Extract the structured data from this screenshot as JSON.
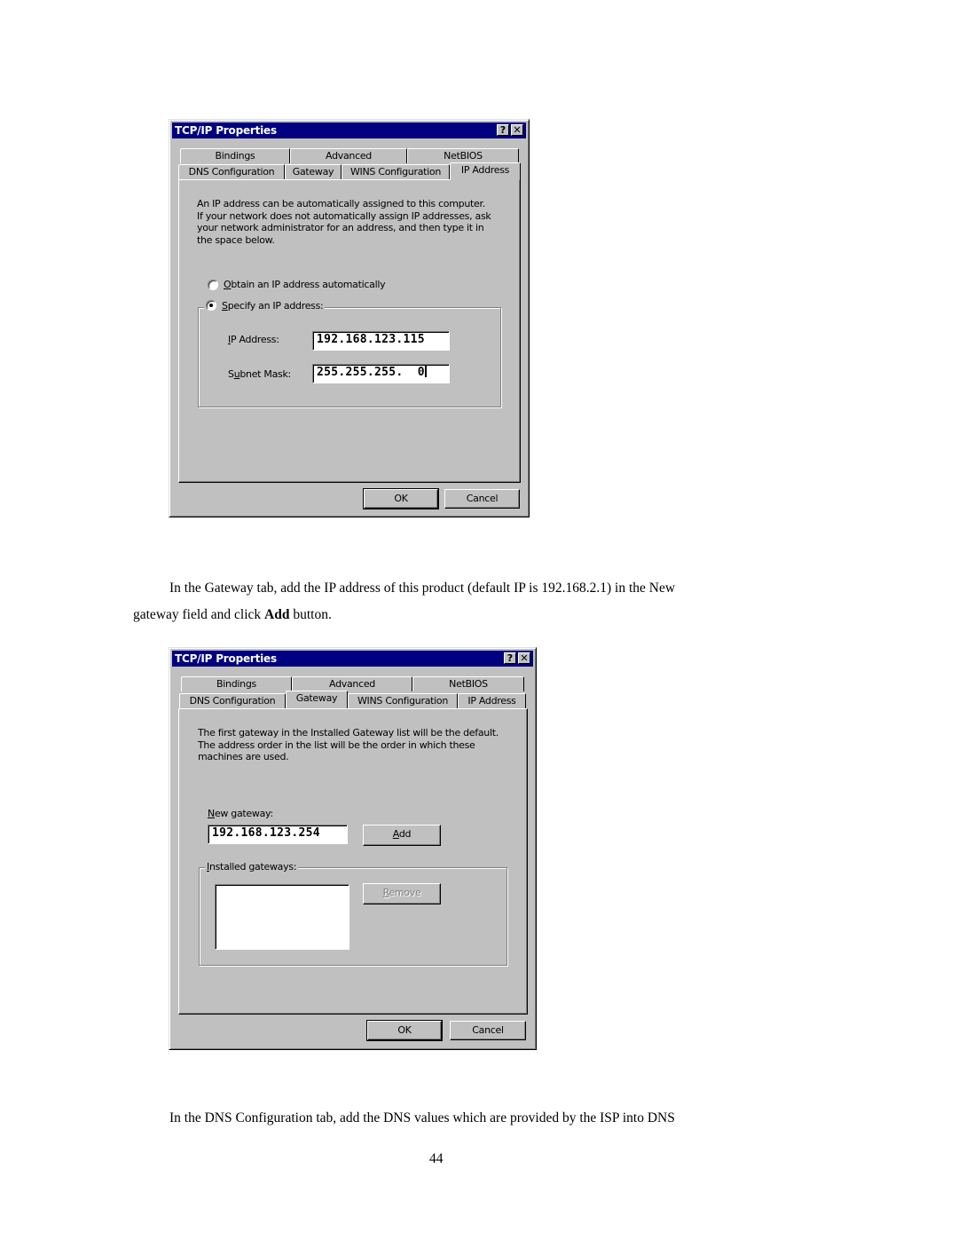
{
  "dialog1": {
    "title": "TCP/IP Properties",
    "help_button": "?",
    "close_button": "✕",
    "tabs_row1": [
      "Bindings",
      "Advanced",
      "NetBIOS"
    ],
    "tabs_row2": [
      "DNS Configuration",
      "Gateway",
      "WINS Configuration",
      "IP Address"
    ],
    "active_tab": "IP Address",
    "description": [
      "An IP address can be automatically assigned to this computer.",
      "If your network does not automatically assign IP addresses, ask",
      "your network administrator for an address, and then type it in",
      "the space below."
    ],
    "radio_auto": {
      "mnemonic": "O",
      "rest": "btain an IP address automatically",
      "selected": false
    },
    "radio_specify": {
      "mnemonic": "S",
      "rest": "pecify an IP address:",
      "selected": true
    },
    "ip_label": {
      "pre": "",
      "mnemonic": "I",
      "rest": "P Address:"
    },
    "ip_value": "192.168.123.115",
    "subnet_label": {
      "pre": "S",
      "mnemonic": "u",
      "rest": "bnet Mask:"
    },
    "subnet_value": "255.255.255.  0",
    "ok_label": "OK",
    "cancel_label": "Cancel"
  },
  "instruction1": {
    "line1": "In the Gateway tab, add the IP address of this product (default IP is 192.168.2.1) in the New",
    "line2_pre": "gateway field and click ",
    "line2_bold": "Add",
    "line2_post": " button."
  },
  "dialog2": {
    "title": "TCP/IP Properties",
    "help_button": "?",
    "close_button": "✕",
    "tabs_row1": [
      "Bindings",
      "Advanced",
      "NetBIOS"
    ],
    "tabs_row2": [
      "DNS Configuration",
      "Gateway",
      "WINS Configuration",
      "IP Address"
    ],
    "active_tab": "Gateway",
    "description": [
      "The first gateway in the Installed Gateway list will be the default.",
      "The address order in the list will be the order in which these",
      "machines are used."
    ],
    "new_gateway_label": {
      "mnemonic": "N",
      "rest": "ew gateway:"
    },
    "new_gateway_value": "192.168.123.254",
    "add_label": {
      "mnemonic": "A",
      "rest": "dd"
    },
    "installed_label": {
      "mnemonic": "I",
      "rest": "nstalled gateways:"
    },
    "installed_items": [],
    "remove_label": {
      "mnemonic": "R",
      "rest": "emove"
    },
    "ok_label": "OK",
    "cancel_label": "Cancel"
  },
  "instruction2": "In the DNS Configuration tab, add the DNS values which are provided by the ISP into DNS",
  "page_number": "44"
}
